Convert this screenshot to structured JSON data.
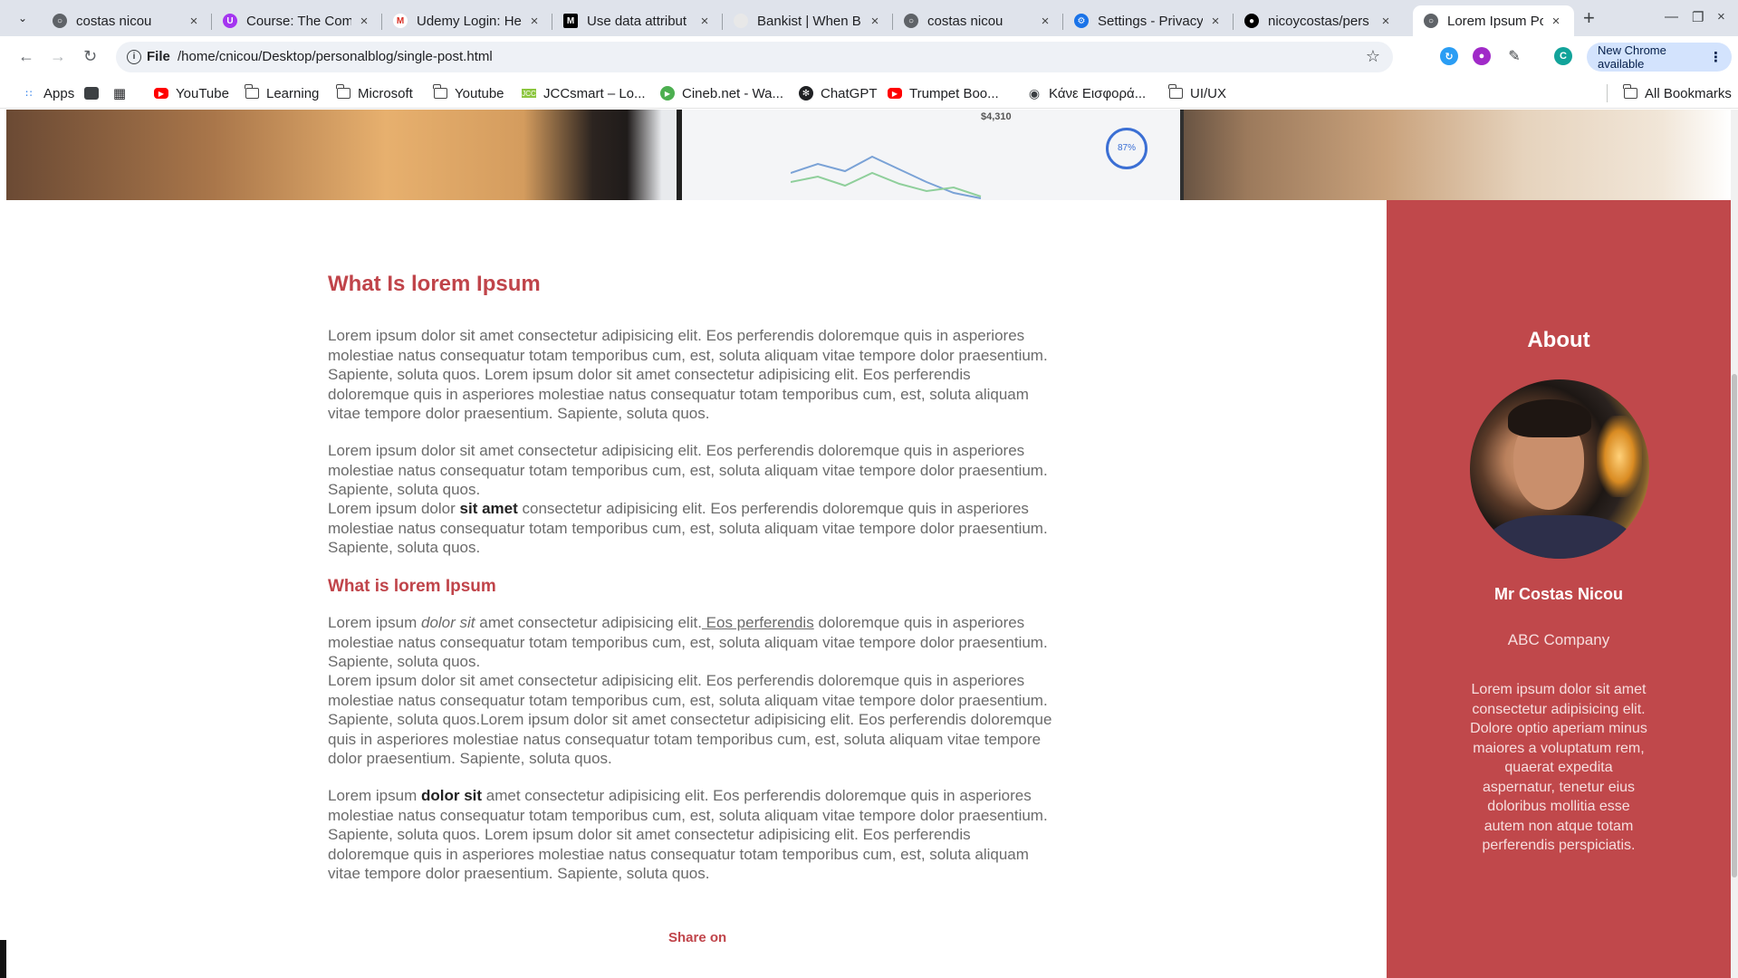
{
  "browser": {
    "tabs": [
      {
        "title": "costas nicou",
        "favicon": "globe-icon",
        "color": "#5f6368"
      },
      {
        "title": "Course: The Comp",
        "favicon": "udemy-icon",
        "color": "#a435f0"
      },
      {
        "title": "Udemy Login: He",
        "favicon": "gmail-icon",
        "color": "#d93025"
      },
      {
        "title": "Use data attribut",
        "favicon": "mdn-icon",
        "color": "#000000"
      },
      {
        "title": "Bankist | When B",
        "favicon": "bankist-icon",
        "color": "#d0d0d0"
      },
      {
        "title": "costas nicou",
        "favicon": "globe-icon",
        "color": "#5f6368"
      },
      {
        "title": "Settings - Privacy",
        "favicon": "settings-icon",
        "color": "#1a73e8"
      },
      {
        "title": "nicoycostas/pers",
        "favicon": "github-icon",
        "color": "#000000"
      },
      {
        "title": "Lorem Ipsum Pos",
        "favicon": "globe-icon",
        "color": "#5f6368",
        "active": true
      }
    ],
    "new_tab_label": "+",
    "address": {
      "scheme": "File",
      "url": "/home/cnicou/Desktop/personalblog/single-post.html"
    },
    "new_chrome_label": "New Chrome available",
    "profile_initial": "C",
    "bookmarks": [
      {
        "label": "Apps",
        "icon": "apps-grid-icon"
      },
      {
        "label": "",
        "icon": "square-icon"
      },
      {
        "label": "",
        "icon": "grid-icon"
      },
      {
        "label": "YouTube",
        "icon": "youtube-icon"
      },
      {
        "label": "Learning",
        "icon": "folder-icon"
      },
      {
        "label": "Microsoft",
        "icon": "folder-icon"
      },
      {
        "label": "Youtube",
        "icon": "folder-icon"
      },
      {
        "label": "JCCsmart – Lo...",
        "icon": "jcc-icon"
      },
      {
        "label": "Cineb.net - Wa...",
        "icon": "cineb-icon"
      },
      {
        "label": "ChatGPT",
        "icon": "chatgpt-icon"
      },
      {
        "label": "Trumpet Boo...",
        "icon": "youtube-icon"
      },
      {
        "label": "Κάνε Εισφορά...",
        "icon": "globe-icon"
      },
      {
        "label": "UI/UX",
        "icon": "folder-icon"
      }
    ],
    "all_bookmarks_label": "All Bookmarks"
  },
  "hero": {
    "stat_text": "$4,310",
    "gauge_text": "87%"
  },
  "post": {
    "heading": "What Is lorem Ipsum",
    "p1": "Lorem ipsum dolor sit amet consectetur adipisicing elit. Eos perferendis doloremque quis in asperiores molestiae natus consequatur totam temporibus cum, est, soluta aliquam vitae tempore dolor praesentium. Sapiente, soluta quos. Lorem ipsum dolor sit amet consectetur adipisicing elit. Eos perferendis doloremque quis in asperiores molestiae natus consequatur totam temporibus cum, est, soluta aliquam vitae tempore dolor praesentium. Sapiente, soluta quos.",
    "p2": "Lorem ipsum dolor sit amet consectetur adipisicing elit. Eos perferendis doloremque quis in asperiores molestiae natus consequatur totam temporibus cum, est, soluta aliquam vitae tempore dolor praesentium. Sapiente, soluta quos.",
    "p3_a": "Lorem ipsum dolor ",
    "p3_b": "sit amet",
    "p3_c": " consectetur adipisicing elit. Eos perferendis doloremque quis in asperiores molestiae natus consequatur totam temporibus cum, est, soluta aliquam vitae tempore dolor praesentium. Sapiente, soluta quos.",
    "subheading": "What is lorem Ipsum",
    "p4_a": "Lorem ipsum ",
    "p4_b": "dolor sit",
    "p4_c": " amet consectetur adipisicing elit.",
    "p4_d": " Eos perferendis",
    "p4_e": " doloremque quis in asperiores molestiae natus consequatur totam temporibus cum, est, soluta aliquam vitae tempore dolor praesentium. Sapiente, soluta quos.",
    "p5": "Lorem ipsum dolor sit amet consectetur adipisicing elit. Eos perferendis doloremque quis in asperiores molestiae natus consequatur totam temporibus cum, est, soluta aliquam vitae tempore dolor praesentium. Sapiente, soluta quos.Lorem ipsum dolor sit amet consectetur adipisicing elit. Eos perferendis doloremque quis in asperiores molestiae natus consequatur totam temporibus cum, est, soluta aliquam vitae tempore dolor praesentium. Sapiente, soluta quos.",
    "p6_a": "Lorem ipsum ",
    "p6_b": "dolor sit",
    "p6_c": " amet consectetur adipisicing elit. Eos perferendis doloremque quis in asperiores molestiae natus consequatur totam temporibus cum, est, soluta aliquam vitae tempore dolor praesentium. Sapiente, soluta quos. Lorem ipsum dolor sit amet consectetur adipisicing elit. Eos perferendis doloremque quis in asperiores molestiae natus consequatur totam temporibus cum, est, soluta aliquam vitae tempore dolor praesentium. Sapiente, soluta quos.",
    "share_label": "Share on"
  },
  "sidebar": {
    "title": "About",
    "name": "Mr Costas Nicou",
    "company": "ABC Company",
    "bio": "Lorem ipsum dolor sit amet consectetur adipisicing elit. Dolore optio aperiam minus maiores a voluptatum rem, quaerat expedita aspernatur, tenetur eius doloribus mollitia esse autem non atque totam perferendis perspiciatis.",
    "accent_color": "#c0484b"
  },
  "colors": {
    "heading": "#c0444a",
    "body_text": "#6b6b6b",
    "tabstrip": "#dfe3eb"
  }
}
